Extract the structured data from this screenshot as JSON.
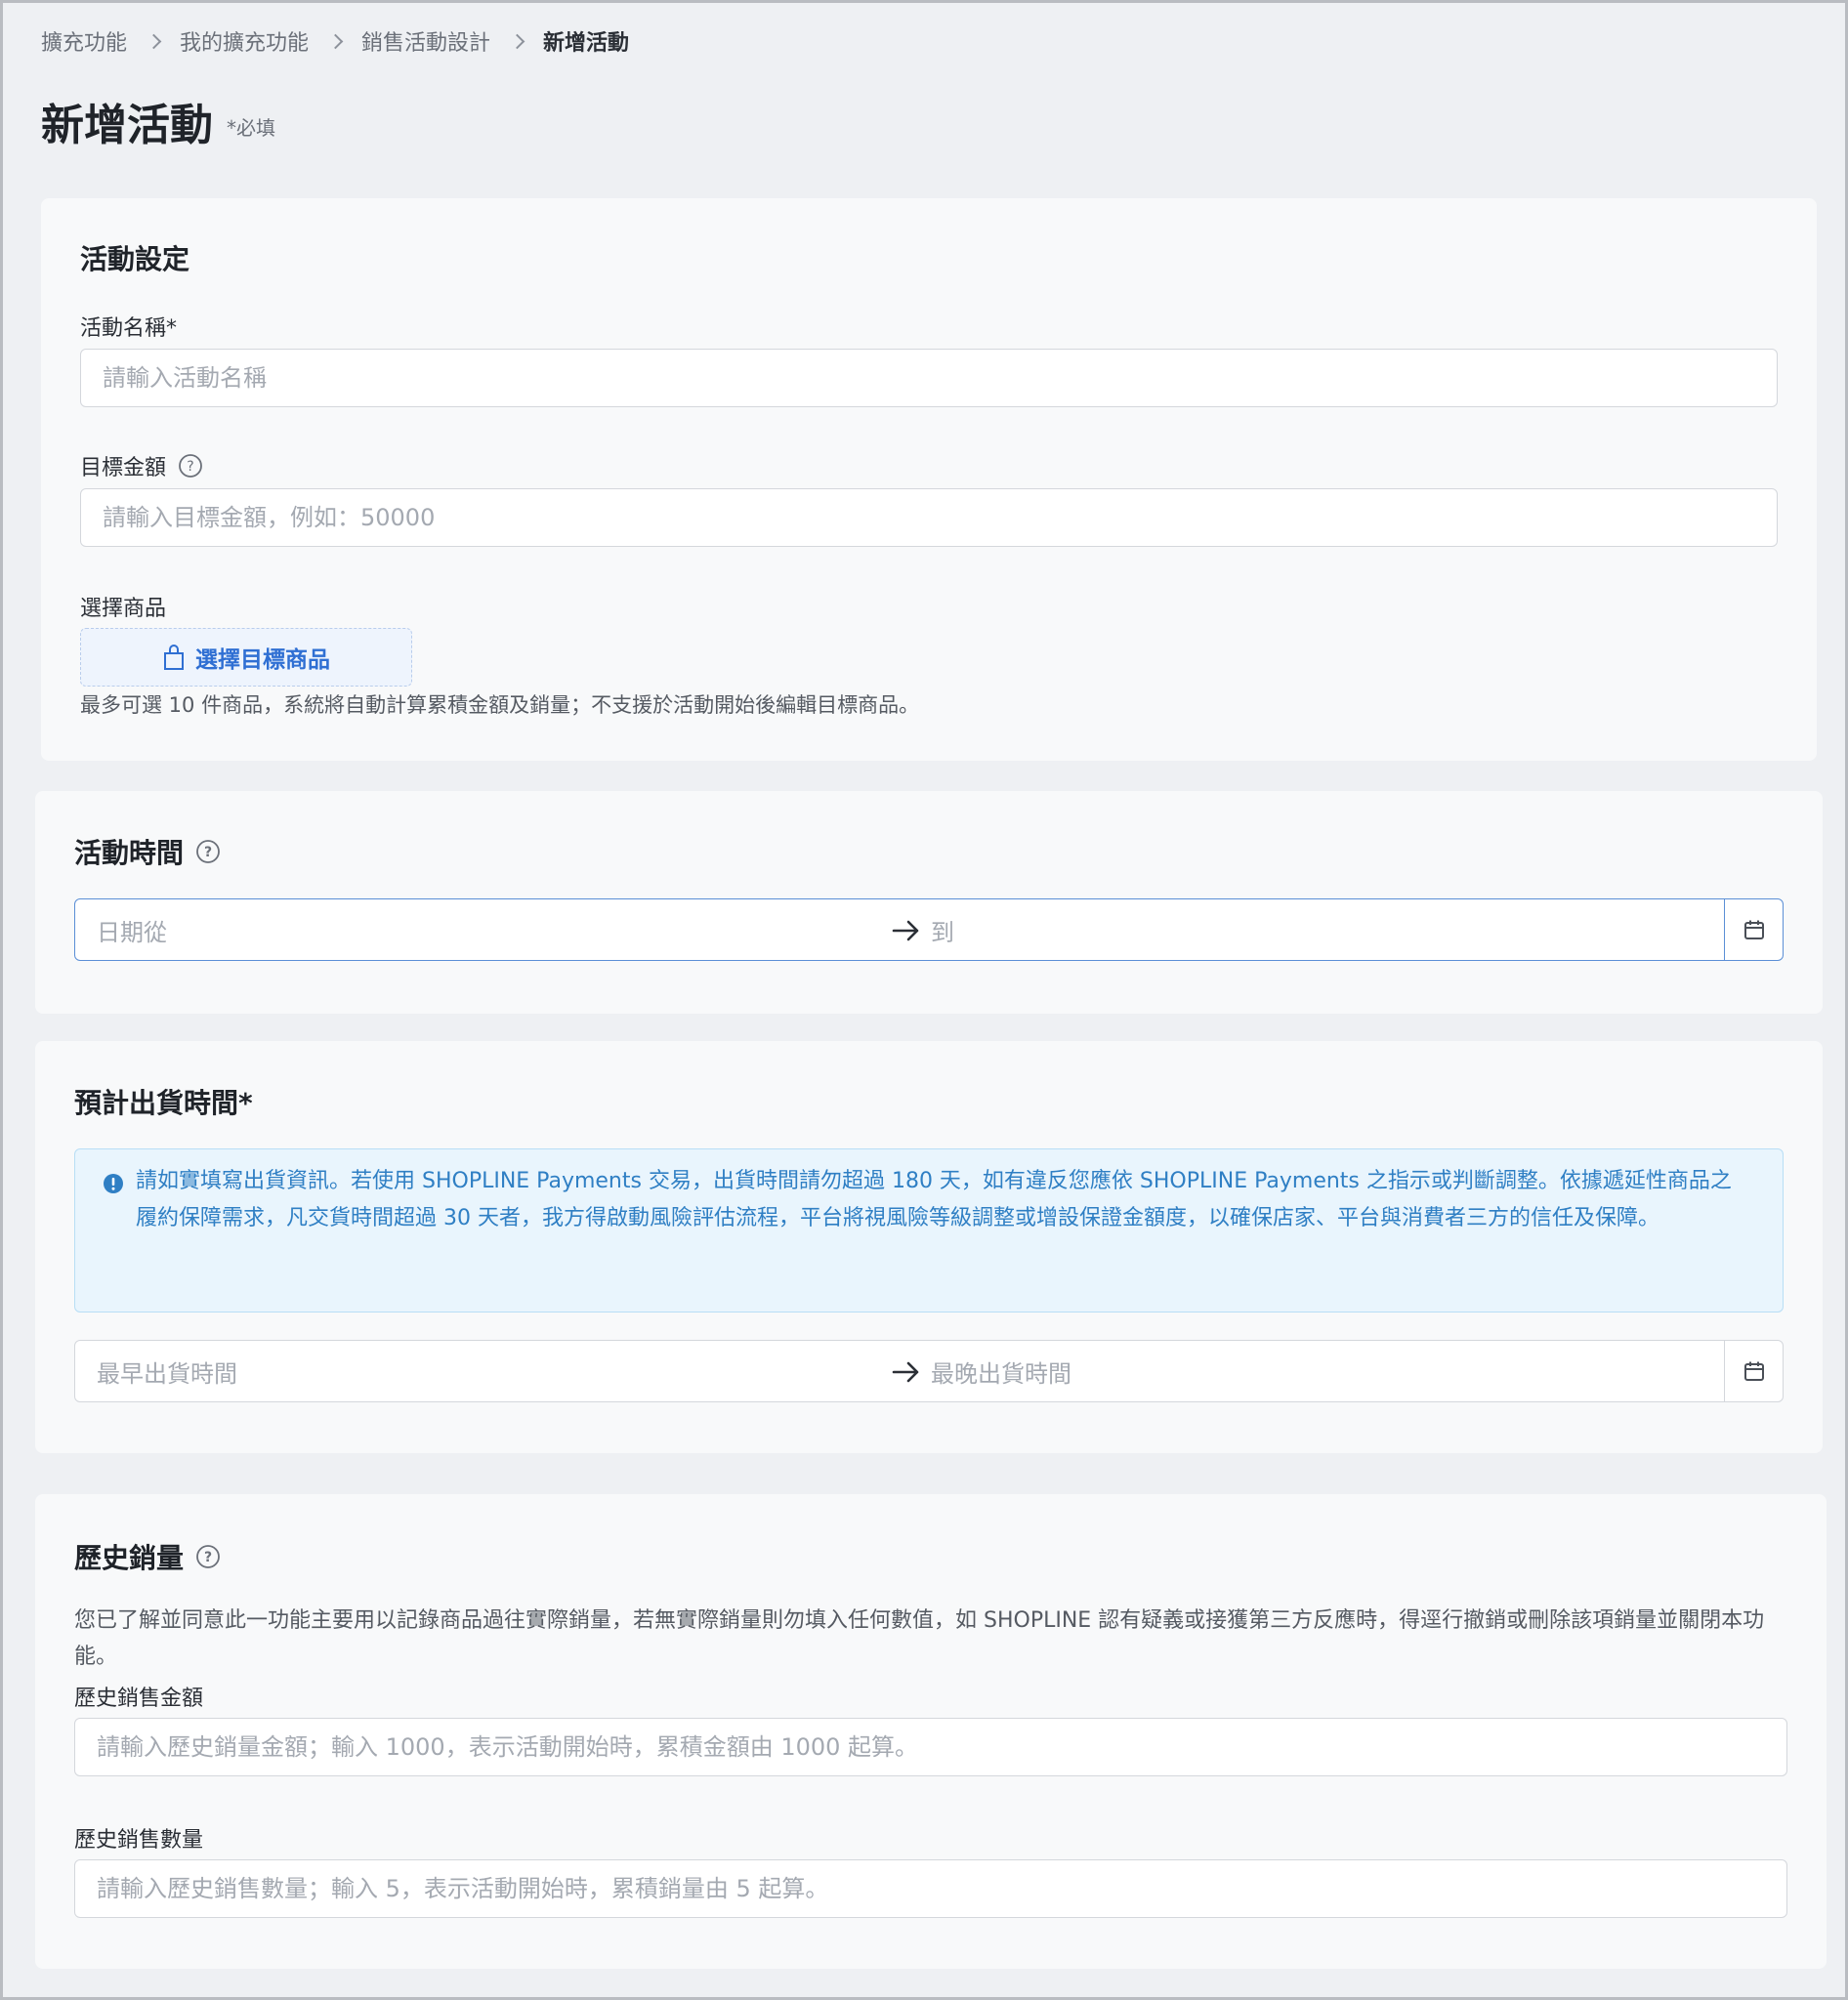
{
  "breadcrumb": {
    "items": [
      "擴充功能",
      "我的擴充功能",
      "銷售活動設計"
    ],
    "current": "新增活動"
  },
  "page": {
    "title": "新增活動",
    "required_note": "*必填"
  },
  "activity_settings": {
    "title": "活動設定",
    "name_label": "活動名稱*",
    "name_placeholder": "請輸入活動名稱",
    "target_label": "目標金額",
    "target_placeholder": "請輸入目標金額，例如：50000",
    "product_label": "選擇商品",
    "select_button": "選擇目標商品",
    "product_hint": "最多可選 10 件商品，系統將自動計算累積金額及銷量；不支援於活動開始後編輯目標商品。"
  },
  "activity_time": {
    "title": "活動時間",
    "from_placeholder": "日期從",
    "to_placeholder": "到"
  },
  "shipping": {
    "title": "預計出貨時間*",
    "notice": "請如實填寫出貨資訊。若使用 SHOPLINE Payments 交易，出貨時間請勿超過 180 天，如有違反您應依 SHOPLINE Payments 之指示或判斷調整。依據遞延性商品之履約保障需求，凡交貨時間超過 30 天者，我方得啟動風險評估流程，平台將視風險等級調整或增設保證金額度，以確保店家、平台與消費者三方的信任及保障。",
    "earliest_placeholder": "最早出貨時間",
    "latest_placeholder": "最晚出貨時間"
  },
  "history": {
    "title": "歷史銷量",
    "description": "您已了解並同意此一功能主要用以記錄商品過往實際銷量，若無實際銷量則勿填入任何數值，如 SHOPLINE 認有疑義或接獲第三方反應時，得逕行撤銷或刪除該項銷量並關閉本功能。",
    "amount_label": "歷史銷售金額",
    "amount_placeholder": "請輸入歷史銷量金額；輸入 1000，表示活動開始時，累積金額由 1000 起算。",
    "quantity_label": "歷史銷售數量",
    "quantity_placeholder": "請輸入歷史銷售數量；輸入 5，表示活動開始時，累積銷量由 5 起算。"
  },
  "colors": {
    "accent": "#2f6fd3",
    "info_bg": "#e9f5fd",
    "info_text": "#2f7fc4"
  }
}
